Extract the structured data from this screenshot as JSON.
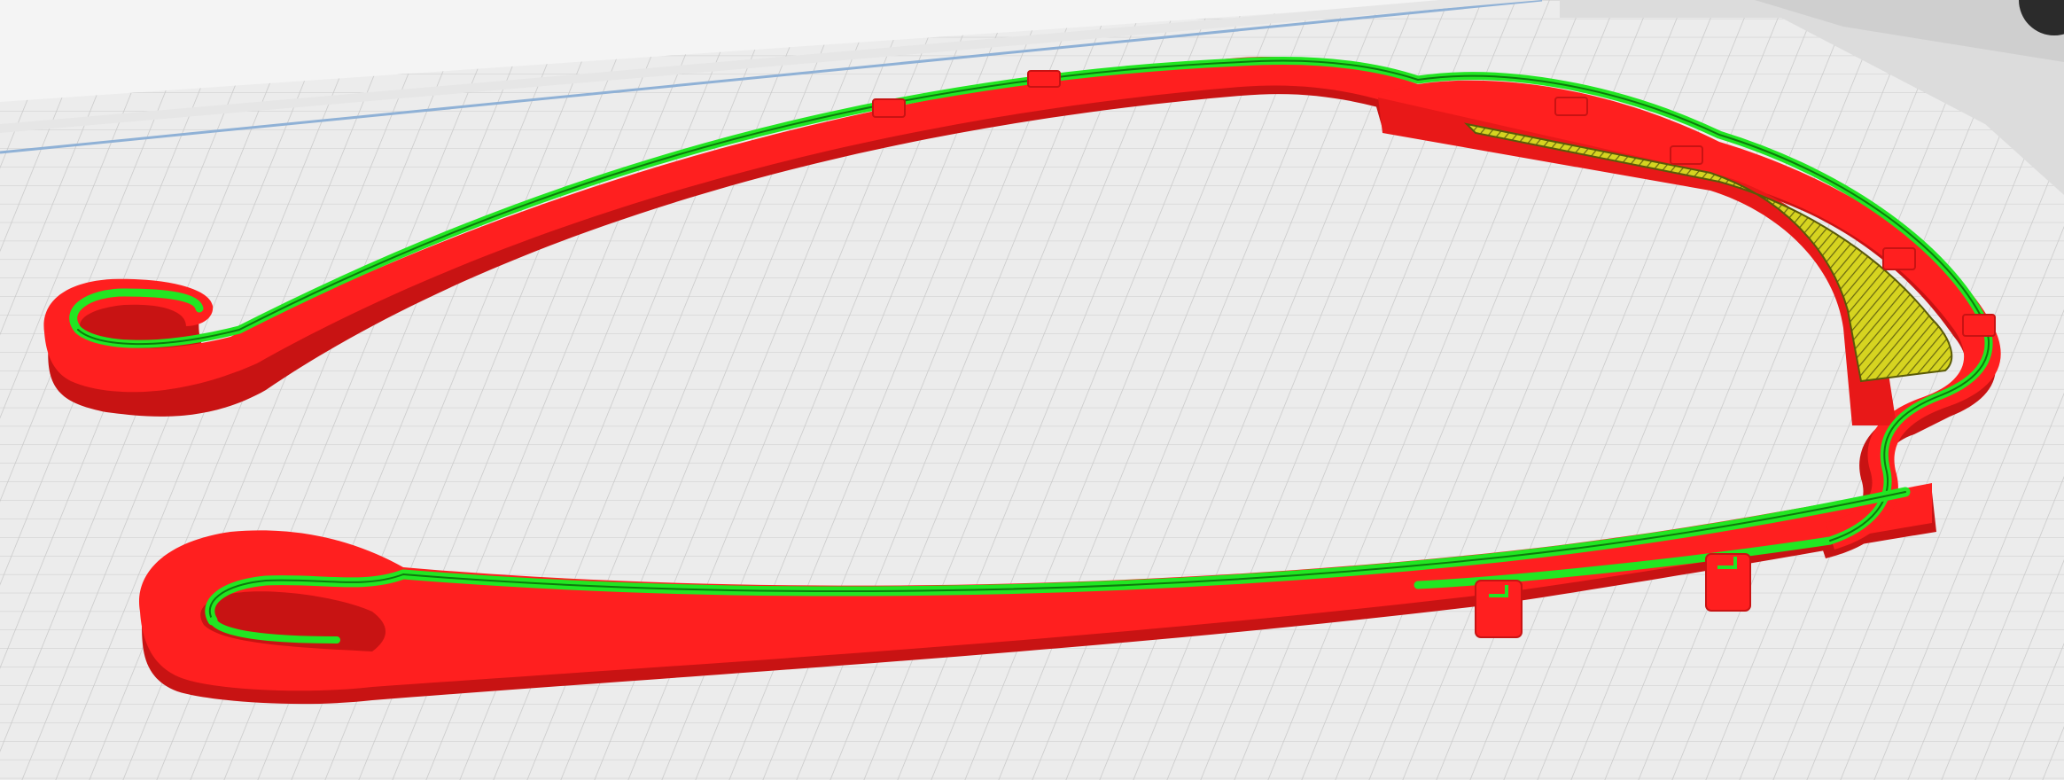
{
  "app": {
    "view": "layer-preview-3d"
  },
  "colors": {
    "background": "#f4f4f4",
    "plate": "#ececec",
    "grid_line": "#c9c9c9",
    "plate_edge": "#8fb1d6",
    "wall_outer": "#ff1f1f",
    "wall_inner": "#22e622",
    "wall_shade": "#c81313",
    "infill": "#c9c922",
    "machine_body": "#dcdcdc"
  },
  "icons": {
    "corner_control": "circle-button-icon"
  }
}
